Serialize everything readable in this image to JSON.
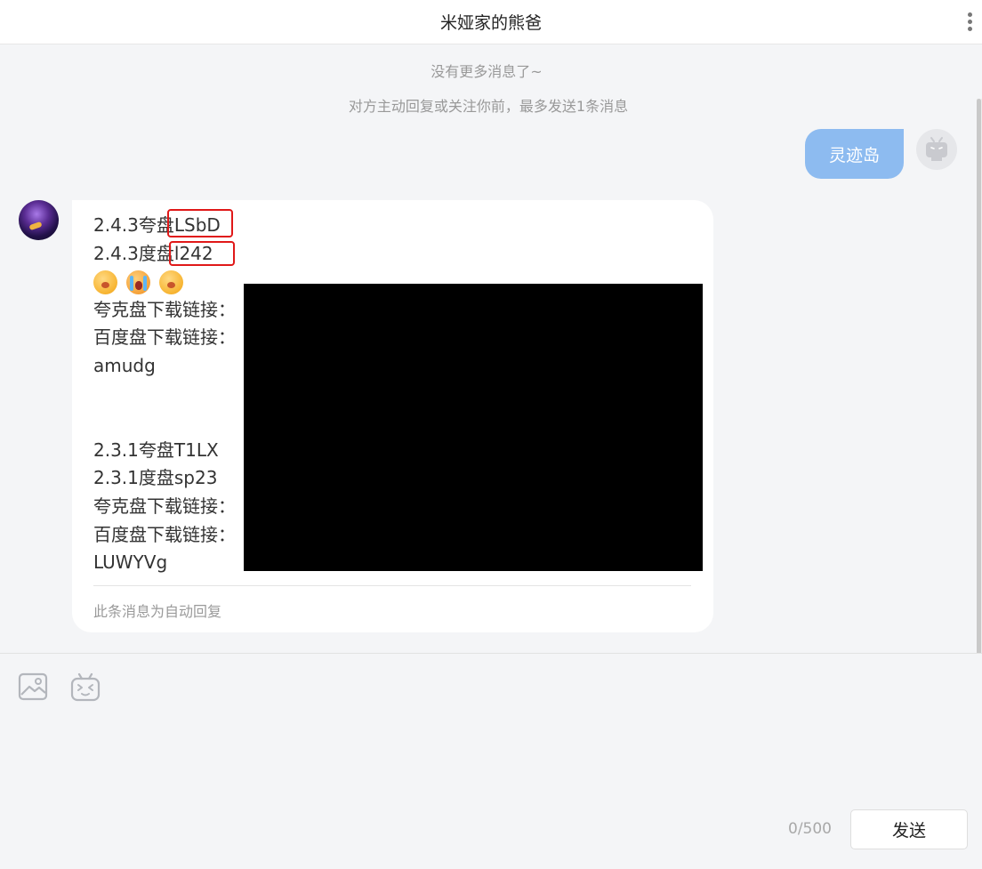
{
  "header": {
    "title": "米娅家的熊爸"
  },
  "system": {
    "no_more": "没有更多消息了~",
    "limit_notice": "对方主动回复或关注你前，最多发送1条消息"
  },
  "sent_message": {
    "text": "灵迹岛"
  },
  "received_message": {
    "lines_top": [
      "2.4.3夸盘LSbD",
      "2.4.3度盘l242"
    ],
    "emojis": [
      "yawn-emoji",
      "crying-emoji",
      "yawn-emoji"
    ],
    "lines_middle": [
      "夸克盘下载链接：",
      "百度盘下载链接：",
      "amudg"
    ],
    "lines_bottom": [
      "2.3.1夸盘T1LX",
      "2.3.1度盘sp23",
      "夸克盘下载链接：",
      "百度盘下载链接：",
      "LUWYVg"
    ],
    "footer": "此条消息为自动回复"
  },
  "composer": {
    "counter": "0/500",
    "send_label": "发送",
    "tools": [
      "image-icon",
      "emoji-icon"
    ]
  },
  "colors": {
    "sent_bubble": "#8dbbf0",
    "highlight_box": "#e01818",
    "background": "#f4f5f7"
  }
}
